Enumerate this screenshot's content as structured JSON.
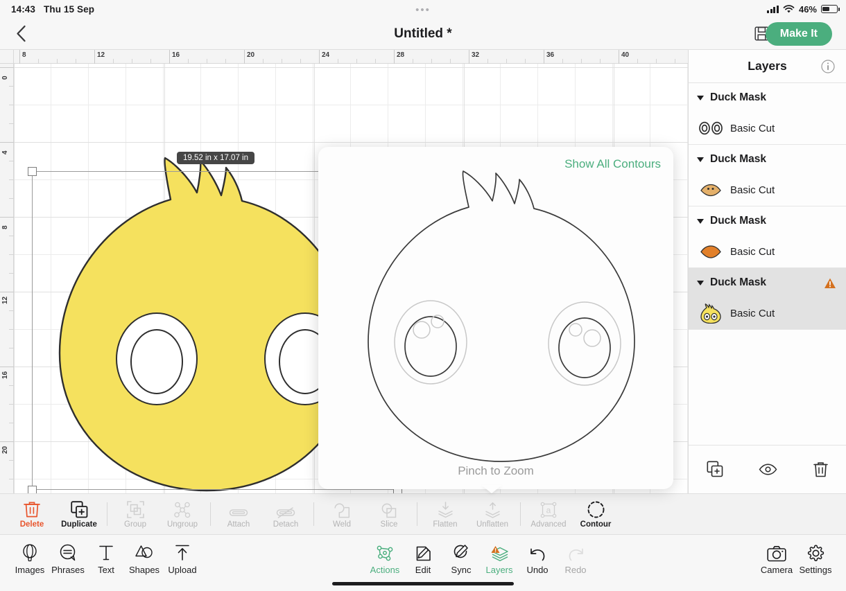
{
  "status_bar": {
    "time": "14:43",
    "date": "Thu 15 Sep",
    "battery_percent": "46%",
    "dots": "•••",
    "wifi_icon": "wifi-icon",
    "signal_icon": "cellular-signal-icon",
    "battery_icon": "battery-icon"
  },
  "top_nav": {
    "back_icon": "chevron-left-icon",
    "title": "Untitled *",
    "save_icon": "save-disk-icon",
    "make_it_label": "Make It"
  },
  "canvas": {
    "dimension_badge": "19.52 in x 17.07 in",
    "rotate_icon": "rotate-handle-icon",
    "ruler_horizontal": [
      "8",
      "12",
      "16",
      "20",
      "24",
      "28",
      "32",
      "36",
      "40"
    ],
    "ruler_vertical": [
      "0",
      "4",
      "8",
      "12",
      "16",
      "20"
    ],
    "shape_fill_color": "#f5e15e",
    "shape_stroke_color": "#2e2e2e"
  },
  "contour_popover": {
    "show_all_label": "Show All Contours",
    "pinch_label": "Pinch to Zoom",
    "visible_stroke": "#3a3a3a",
    "hidden_stroke": "#c8c8c8"
  },
  "layers_panel": {
    "title": "Layers",
    "info_icon": "info-circle-icon",
    "groups": [
      {
        "name": "Duck Mask",
        "operation": "Basic Cut",
        "thumb": "two-eye-rings-thumb",
        "selected": false,
        "warning": false
      },
      {
        "name": "Duck Mask",
        "operation": "Basic Cut",
        "thumb": "duck-beak-tan-thumb",
        "selected": false,
        "warning": false
      },
      {
        "name": "Duck Mask",
        "operation": "Basic Cut",
        "thumb": "duck-beak-orange-thumb",
        "selected": false,
        "warning": false
      },
      {
        "name": "Duck Mask",
        "operation": "Basic Cut",
        "thumb": "duck-head-yellow-thumb",
        "selected": true,
        "warning": true
      }
    ],
    "footer": [
      {
        "name": "duplicate-layer-button",
        "icon": "duplicate-squares-icon"
      },
      {
        "name": "visibility-button",
        "icon": "eye-icon"
      },
      {
        "name": "delete-layer-button",
        "icon": "trash-icon"
      }
    ]
  },
  "action_toolbar": [
    {
      "label": "Delete",
      "icon": "trash-icon",
      "state": "danger"
    },
    {
      "label": "Duplicate",
      "icon": "duplicate-squares-icon",
      "state": "strong"
    },
    {
      "label": "Group",
      "icon": "group-icon",
      "state": "disabled"
    },
    {
      "label": "Ungroup",
      "icon": "ungroup-nodes-icon",
      "state": "disabled"
    },
    {
      "label": "Attach",
      "icon": "paperclip-icon",
      "state": "disabled"
    },
    {
      "label": "Detach",
      "icon": "paperclip-slash-icon",
      "state": "disabled"
    },
    {
      "label": "Weld",
      "icon": "weld-shapes-icon",
      "state": "disabled"
    },
    {
      "label": "Slice",
      "icon": "slice-shapes-icon",
      "state": "disabled"
    },
    {
      "label": "Flatten",
      "icon": "flatten-down-icon",
      "state": "disabled"
    },
    {
      "label": "Unflatten",
      "icon": "unflatten-up-icon",
      "state": "disabled"
    },
    {
      "label": "Advanced",
      "icon": "advanced-a-box-icon",
      "state": "disabled"
    },
    {
      "label": "Contour",
      "icon": "contour-dashed-circle-icon",
      "state": "strong"
    }
  ],
  "bottom_nav": {
    "left": [
      {
        "label": "Images",
        "icon": "balloon-icon"
      },
      {
        "label": "Phrases",
        "icon": "speech-bubble-icon"
      },
      {
        "label": "Text",
        "icon": "text-t-icon"
      },
      {
        "label": "Shapes",
        "icon": "shapes-icon"
      },
      {
        "label": "Upload",
        "icon": "upload-arrow-icon"
      }
    ],
    "center": [
      {
        "label": "Actions",
        "icon": "actions-nodes-icon",
        "state": "active"
      },
      {
        "label": "Edit",
        "icon": "edit-pencil-icon",
        "state": "normal"
      },
      {
        "label": "Sync",
        "icon": "sync-pencil-icon",
        "state": "normal"
      },
      {
        "label": "Layers",
        "icon": "layers-stack-icon",
        "state": "active"
      },
      {
        "label": "Undo",
        "icon": "undo-arrow-icon",
        "state": "normal"
      },
      {
        "label": "Redo",
        "icon": "redo-arrow-icon",
        "state": "disabled"
      }
    ],
    "right": [
      {
        "label": "Camera",
        "icon": "camera-icon"
      },
      {
        "label": "Settings",
        "icon": "gear-icon"
      }
    ]
  },
  "colors": {
    "accent_green": "#4bae7e",
    "danger_red": "#e8552d",
    "warning_orange": "#d4711f",
    "duck_yellow": "#f5e15e",
    "beak_orange": "#e2802a",
    "beak_tan": "#e4b06a"
  }
}
